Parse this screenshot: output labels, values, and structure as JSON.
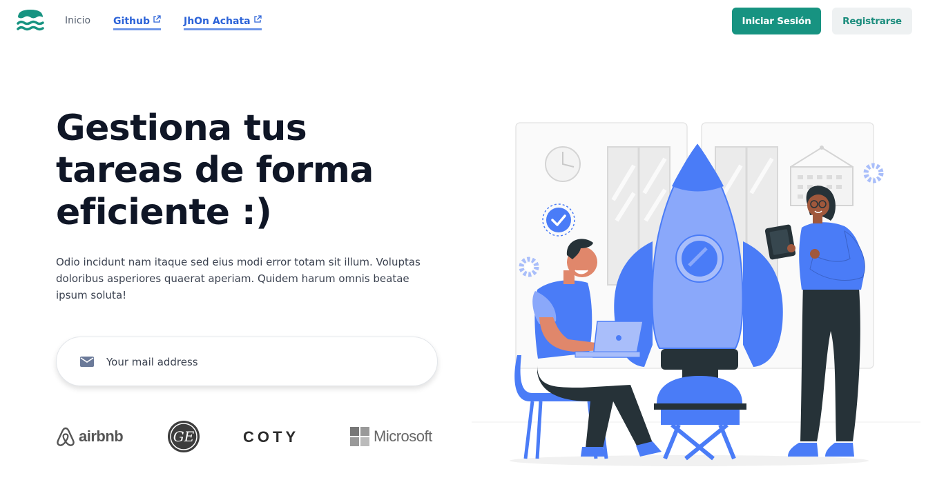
{
  "header": {
    "nav": {
      "home_label": "Inicio",
      "github_label": "Github",
      "author_label": "JhOn Achata"
    },
    "login_label": "Iniciar Sesión",
    "register_label": "Registrarse"
  },
  "hero": {
    "title_line1": "Gestiona tus",
    "title_line2": "tareas de forma",
    "title_line3": "eficiente :)",
    "description": "Odio incidunt nam itaque sed eius modi error totam sit illum. Voluptas doloribus asperiores quaerat aperiam. Quidem harum omnis beatae ipsum soluta!",
    "email_placeholder": "Your mail address"
  },
  "brands": {
    "airbnb": "airbnb",
    "ge": "GE",
    "coty": "COTY",
    "microsoft": "Microsoft"
  },
  "colors": {
    "primary": "#179381",
    "link": "#2c63d8",
    "illustration_blue": "#4a7cf7",
    "heading": "#0f1626"
  }
}
